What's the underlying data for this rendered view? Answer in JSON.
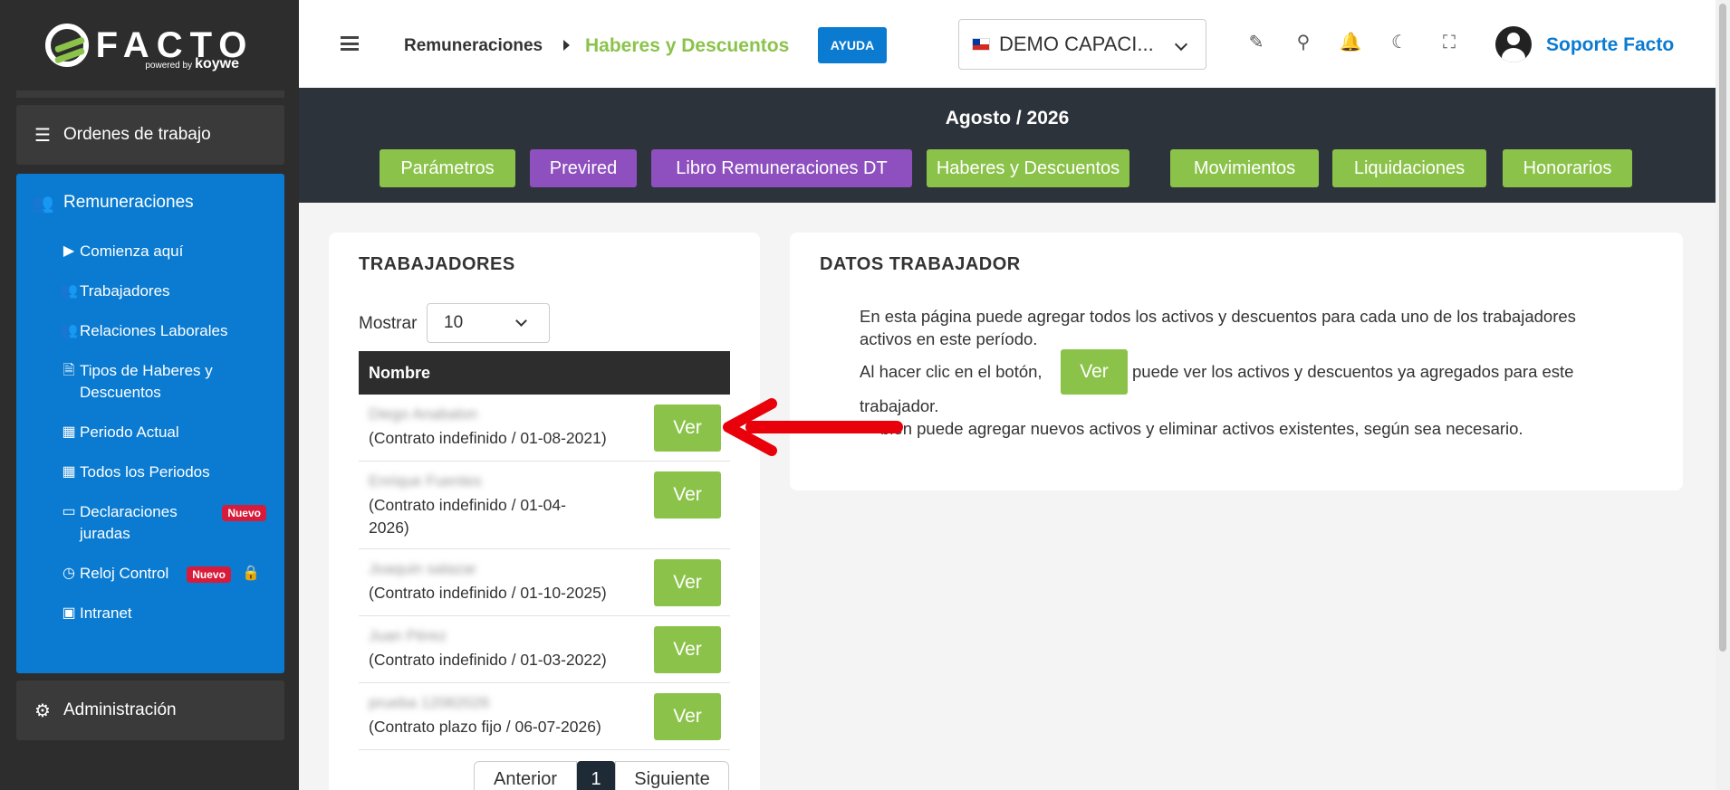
{
  "brand": {
    "name": "FACTO",
    "powered_prefix": "powered by",
    "powered_name": "koywe"
  },
  "sidebar": {
    "ordenes": {
      "label": "Ordenes de trabajo",
      "icon": "tasks-icon"
    },
    "remuneraciones": {
      "label": "Remuneraciones",
      "icon": "users-icon",
      "items": [
        {
          "label": "Comienza aquí",
          "icon": "play-icon"
        },
        {
          "label": "Trabajadores",
          "icon": "users-group-icon"
        },
        {
          "label": "Relaciones Laborales",
          "icon": "user-friends-icon"
        },
        {
          "label": "Tipos de Haberes y Descuentos",
          "icon": "file-icon"
        },
        {
          "label": "Periodo Actual",
          "icon": "calendar-day-icon"
        },
        {
          "label": "Todos los Periodos",
          "icon": "calendar-icon"
        },
        {
          "label": "Declaraciones juradas",
          "icon": "archive-icon",
          "badge": "Nuevo"
        },
        {
          "label": "Reloj Control",
          "icon": "clock-icon",
          "badge": "Nuevo",
          "locked": true
        },
        {
          "label": "Intranet",
          "icon": "intranet-icon"
        }
      ]
    },
    "administracion": {
      "label": "Administración",
      "icon": "gears-icon"
    }
  },
  "header": {
    "breadcrumb_parent": "Remuneraciones",
    "breadcrumb_current": "Haberes y Descuentos",
    "help_label": "AYUDA",
    "company": "DEMO CAPACI...",
    "user_name": "Soporte Facto"
  },
  "band": {
    "period": "Agosto / 2026",
    "tabs": [
      {
        "label": "Parámetros",
        "color": "#8bc34a"
      },
      {
        "label": "Previred",
        "color": "#8e4fbf"
      },
      {
        "label": "Libro Remuneraciones DT",
        "color": "#8e4fbf"
      },
      {
        "label": "Haberes y Descuentos",
        "color": "#8bc34a"
      },
      {
        "label": "Movimientos",
        "color": "#8bc34a"
      },
      {
        "label": "Liquidaciones",
        "color": "#8bc34a"
      },
      {
        "label": "Honorarios",
        "color": "#8bc34a"
      }
    ]
  },
  "workers": {
    "title": "TRABAJADORES",
    "show_label": "Mostrar",
    "show_value": "10",
    "column_name": "Nombre",
    "ver_label": "Ver",
    "rows": [
      {
        "name": "Diego Anabalon",
        "contract": "(Contrato indefinido / 01-08-2021)"
      },
      {
        "name": "Enrique Fuentes",
        "contract": "(Contrato indefinido / 01-04-2026)"
      },
      {
        "name": "Joaquin salazar",
        "contract": "(Contrato indefinido / 01-10-2025)"
      },
      {
        "name": "Juan Pérez",
        "contract": "(Contrato indefinido / 01-03-2022)"
      },
      {
        "name": "prueba 12082026",
        "contract": "(Contrato plazo fijo / 06-07-2026)"
      }
    ],
    "pager": {
      "prev": "Anterior",
      "page": "1",
      "next": "Siguiente"
    }
  },
  "worker_data": {
    "title": "DATOS TRABAJADOR",
    "line1": "En esta página puede agregar todos los activos y descuentos para cada uno de los trabajadores",
    "line2": "activos en este período.",
    "line3a": "Al hacer clic en el botón,",
    "line3_btn": "Ver",
    "line3b": "puede ver los activos y descuentos ya agregados para este",
    "line4": "trabajador.",
    "line5": "bién puede agregar nuevos activos y eliminar activos existentes, según sea necesario."
  },
  "colors": {
    "accent_green": "#8bc34a",
    "accent_blue": "#0a7bd1",
    "purple": "#8e4fbf",
    "dark": "#2d2d2d",
    "arrow_red": "#e8000b"
  }
}
